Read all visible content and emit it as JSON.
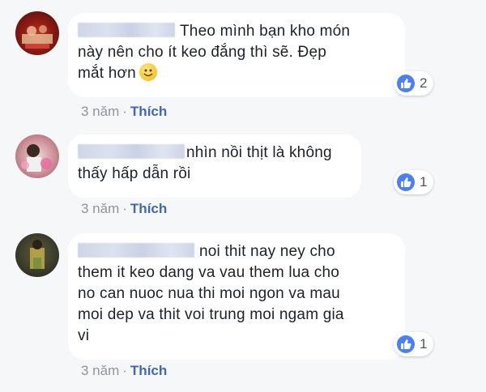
{
  "comments": [
    {
      "text_line1": "Theo mình bạn kho món",
      "text_line2": "này nên cho ít keo đắng thì sẽ. Đẹp",
      "text_line3": "mắt hơn",
      "reactions": "2",
      "time": "3 năm",
      "like_label": "Thích"
    },
    {
      "text_line1": "nhìn nồi thịt là không",
      "text_line2": "thấy hấp dẫn rồi",
      "reactions": "1",
      "time": "3 năm",
      "like_label": "Thích"
    },
    {
      "text_line1": "noi thit nay ney cho",
      "text_line2": "them it keo dang va vau them lua cho",
      "text_line3": "no can nuoc nua thi moi ngon va mau",
      "text_line4": "moi dep va thit voi trung moi ngam gia",
      "text_line5": "vi",
      "reactions": "1",
      "time": "3 năm",
      "like_label": "Thích"
    }
  ],
  "colors": {
    "background": "#f6f7f9",
    "bubble": "#ffffff",
    "link": "#4267b2",
    "like_badge": "#4a80f5",
    "meta_text": "#90949c"
  },
  "icons": [
    "like-thumb-icon",
    "smile-emoji-icon",
    "avatar"
  ]
}
